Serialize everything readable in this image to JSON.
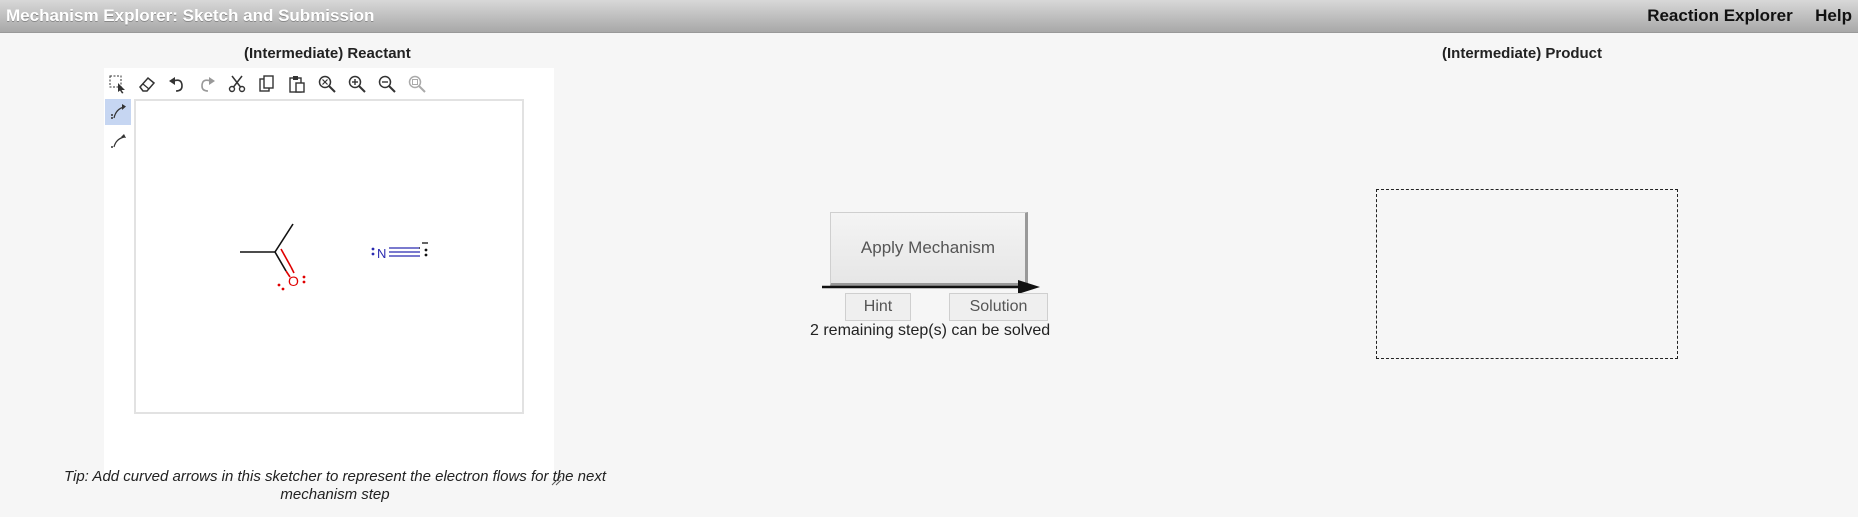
{
  "window": {
    "title": "Mechanism Explorer: Sketch and Submission"
  },
  "menu": {
    "reaction_explorer": "Reaction Explorer",
    "help": "Help"
  },
  "reactant": {
    "heading": "(Intermediate) Reactant",
    "toolbar": [
      "select-tool",
      "erase-tool",
      "undo",
      "redo",
      "cut",
      "copy",
      "paste",
      "zoom-to-fit",
      "zoom-in",
      "zoom-out",
      "zoom-reset"
    ],
    "side_tools": [
      "curved-arrow-pair",
      "curved-arrow-single"
    ],
    "molecules": {
      "nitrogen_label": "N",
      "oxygen_label": "O"
    },
    "tip": "Tip: Add curved arrows in this sketcher to represent the electron flows for the next mechanism step"
  },
  "center": {
    "apply_label": "Apply Mechanism",
    "hint_label": "Hint",
    "solution_label": "Solution",
    "steps_text": "2 remaining step(s) can be solved"
  },
  "product": {
    "heading": "(Intermediate) Product"
  },
  "colors": {
    "oxygen": "#e00000",
    "nitrogen": "#2a2ab0",
    "selected_tool": "#c6d6f2"
  }
}
